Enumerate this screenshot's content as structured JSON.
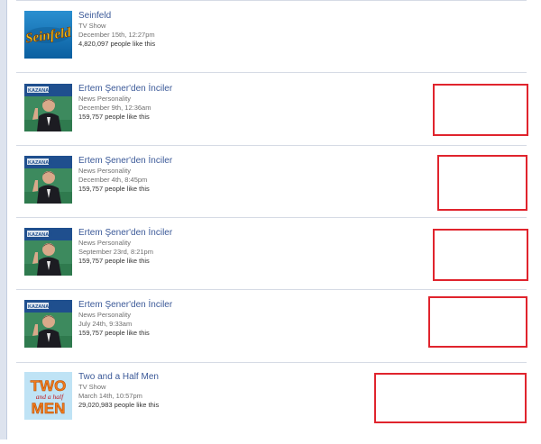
{
  "colors": {
    "link": "#3b5998",
    "annotation_box": "#e0242d",
    "separator": "#d6dbe5"
  },
  "items": [
    {
      "title": "Seinfeld",
      "category": "TV Show",
      "timestamp": "December 15th, 12:27pm",
      "likes": "4,820,097 people like this",
      "thumbnail_text": "Seinfeld"
    },
    {
      "title": "Ertem Şener'den İnciler",
      "category": "News Personality",
      "timestamp": "December 9th, 12:36am",
      "likes": "159,757 people like this",
      "thumbnail_text": "KAZANAN"
    },
    {
      "title": "Ertem Şener'den İnciler",
      "category": "News Personality",
      "timestamp": "December 4th, 8:45pm",
      "likes": "159,757 people like this",
      "thumbnail_text": "KAZANAN"
    },
    {
      "title": "Ertem Şener'den İnciler",
      "category": "News Personality",
      "timestamp": "September 23rd, 8:21pm",
      "likes": "159,757 people like this",
      "thumbnail_text": "KAZANAN"
    },
    {
      "title": "Ertem Şener'den İnciler",
      "category": "News Personality",
      "timestamp": "July 24th, 9:33am",
      "likes": "159,757 people like this",
      "thumbnail_text": "KAZANAN"
    },
    {
      "title": "Two and a Half Men",
      "category": "TV Show",
      "timestamp": "March 14th, 10:57pm",
      "likes": "29,020,983 people like this",
      "thumbnail_text": [
        "TWO",
        "and a half",
        "MEN"
      ]
    }
  ]
}
